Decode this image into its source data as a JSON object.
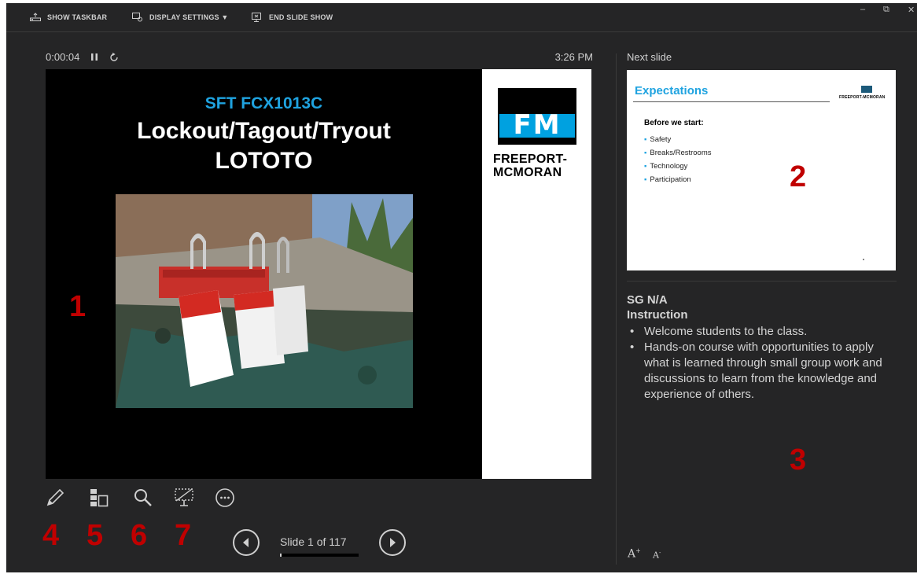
{
  "toolbar": {
    "show_taskbar": "SHOW TASKBAR",
    "display_settings": "DISPLAY SETTINGS ▼",
    "end_slide_show": "END SLIDE SHOW"
  },
  "window_controls": {
    "minimize": "–",
    "restore": "⧉",
    "close": "✕"
  },
  "presenter": {
    "elapsed_time": "0:00:04",
    "clock": "3:26 PM",
    "next_slide_label": "Next slide"
  },
  "current_slide": {
    "course_code": "SFT FCX1013C",
    "title_line1": "Lockout/Tagout/Tryout",
    "title_line2": "LOTOTO",
    "logo_mark": "FM",
    "logo_text_line1": "FREEPORT-",
    "logo_text_line2": "MCMORAN"
  },
  "next_slide": {
    "title": "Expectations",
    "logo_text": "FREEPORT-MCMORAN",
    "heading": "Before we start:",
    "items": [
      "Safety",
      "Breaks/Restrooms",
      "Technology",
      "Participation"
    ]
  },
  "notes": {
    "line1": "SG N/A",
    "line2": "Instruction",
    "bullets": [
      "Welcome students to the class.",
      "Hands-on course with opportunities to apply what is learned through small group work and discussions to learn from the knowledge and experience of others."
    ]
  },
  "navigation": {
    "slide_counter": "Slide 1 of 117",
    "progress": 0.0085
  },
  "annotations": [
    "1",
    "2",
    "3",
    "4",
    "5",
    "6",
    "7"
  ],
  "font_controls": {
    "increase": "A",
    "decrease": "A"
  },
  "colors": {
    "background": "#252526",
    "accent_blue": "#1fa3e0",
    "annotation_red": "#c00000"
  }
}
